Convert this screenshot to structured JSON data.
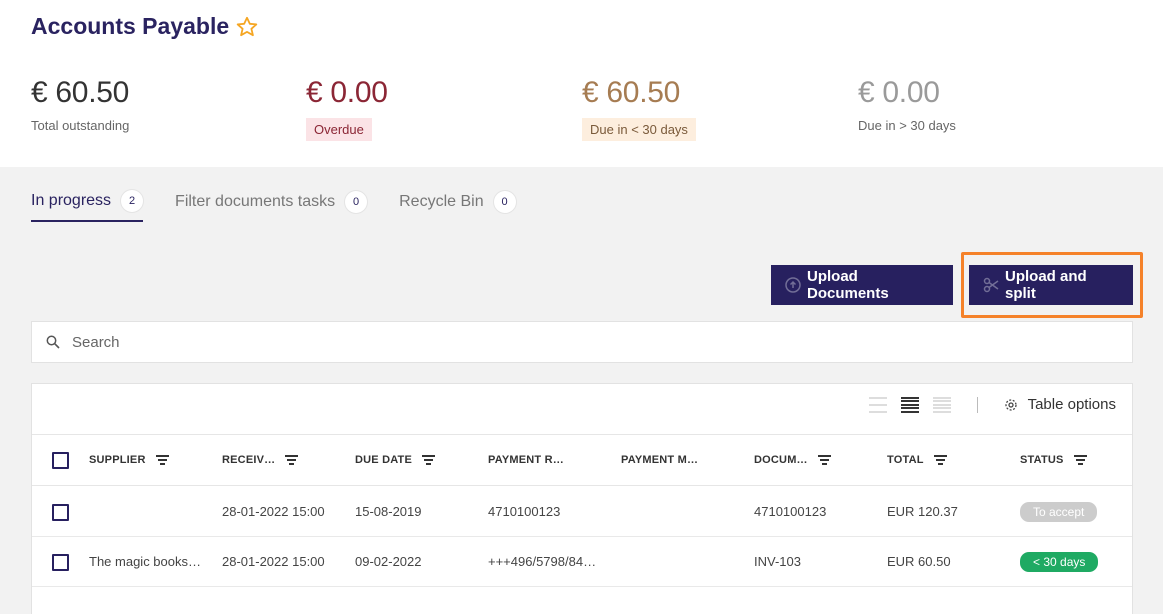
{
  "page": {
    "title": "Accounts Payable"
  },
  "stats": [
    {
      "amount": "€ 60.50",
      "label": "Total outstanding",
      "color": "#333333"
    },
    {
      "amount": "€ 0.00",
      "label": "Overdue",
      "color": "#8b2635",
      "badge_bg": "#fbe3e6"
    },
    {
      "amount": "€ 60.50",
      "label": "Due in < 30 days",
      "color": "#a67c52",
      "badge_bg": "#fdeede"
    },
    {
      "amount": "€ 0.00",
      "label": "Due in > 30 days",
      "color": "#9a9a9a"
    }
  ],
  "tabs": [
    {
      "label": "In progress",
      "count": "2"
    },
    {
      "label": "Filter documents tasks",
      "count": "0"
    },
    {
      "label": "Recycle Bin",
      "count": "0"
    }
  ],
  "actions": {
    "upload_documents": "Upload Documents",
    "upload_and_split": "Upload and split"
  },
  "search": {
    "placeholder": "Search"
  },
  "table": {
    "options_label": "Table options",
    "columns": [
      "SUPPLIER",
      "RECEIV…",
      "DUE DATE",
      "PAYMENT R…",
      "PAYMENT M…",
      "DOCUM…",
      "TOTAL",
      "STATUS"
    ],
    "rows": [
      {
        "supplier": "",
        "received": "28-01-2022 15:00",
        "due_date": "15-08-2019",
        "payment_ref": "4710100123",
        "payment_method": "",
        "document": "4710100123",
        "total": "EUR 120.37",
        "status": "To accept",
        "status_color": "#cccccc"
      },
      {
        "supplier": "The magic books…",
        "received": "28-01-2022 15:00",
        "due_date": "09-02-2022",
        "payment_ref": "+++496/5798/84…",
        "payment_method": "",
        "document": "INV-103",
        "total": "EUR 60.50",
        "status": "< 30 days",
        "status_color": "#1faa63"
      }
    ]
  },
  "colors": {
    "brand": "#27205f",
    "highlight": "#f5822a",
    "star": "#f5a623"
  }
}
